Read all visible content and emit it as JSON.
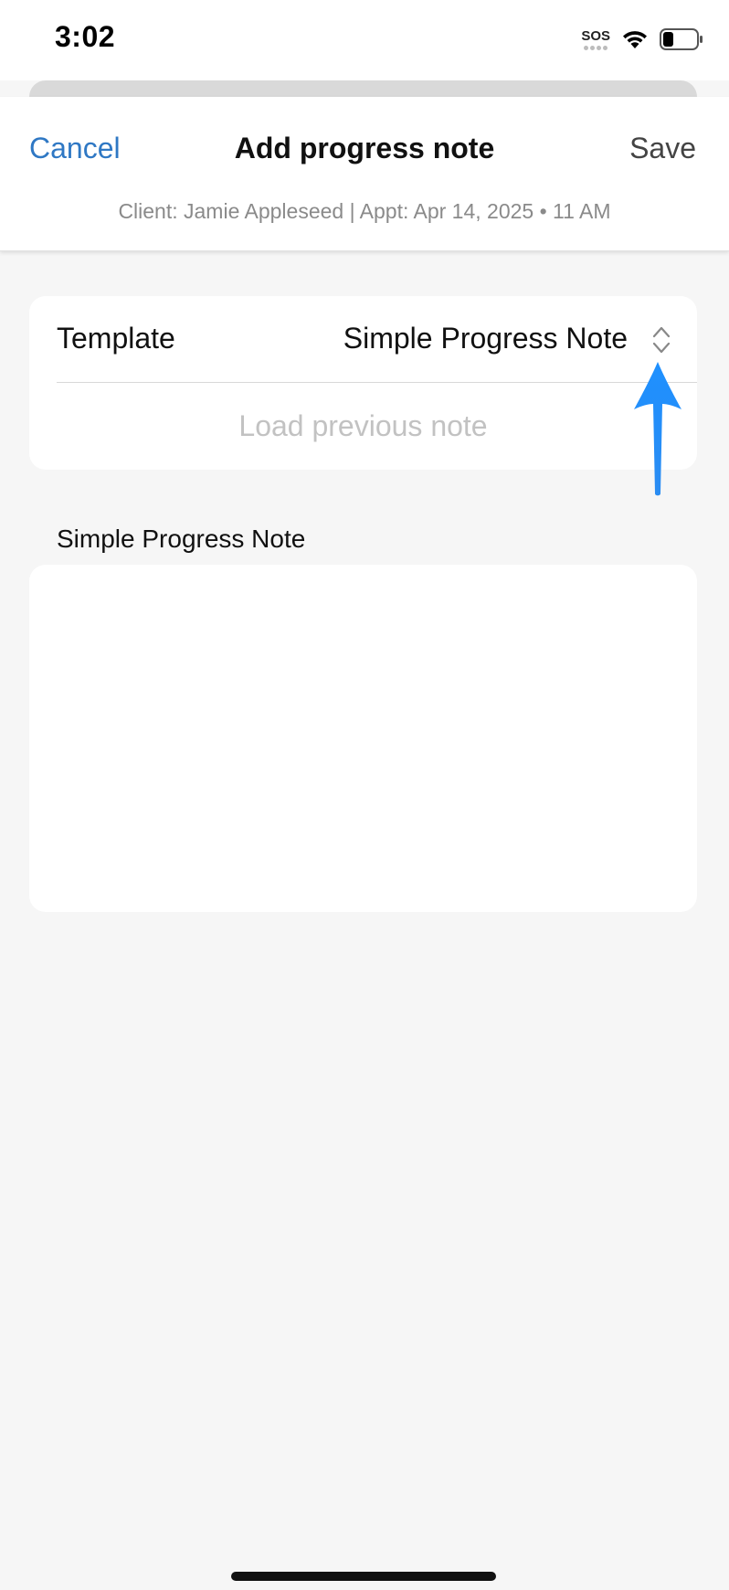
{
  "status_bar": {
    "time": "3:02",
    "sos_label": "SOS",
    "icons": [
      "sos-icon",
      "wifi-icon",
      "battery-icon"
    ],
    "battery_level": 0.3
  },
  "nav": {
    "cancel_label": "Cancel",
    "title": "Add progress note",
    "save_label": "Save",
    "subtitle": "Client: Jamie Appleseed | Appt: Apr 14, 2025 • 11 AM"
  },
  "template_card": {
    "template_label": "Template",
    "template_value": "Simple Progress Note",
    "template_icon": "chevron-up-down-icon",
    "load_previous_label": "Load previous note"
  },
  "note_section": {
    "label": "Simple Progress Note",
    "value": ""
  },
  "annotation": {
    "arrow_icon": "up-arrow-icon",
    "color": "#1e90ff"
  },
  "colors": {
    "accent": "#2f78c4",
    "background": "#f6f6f6",
    "card": "#ffffff",
    "placeholder": "#c2c2c2"
  }
}
